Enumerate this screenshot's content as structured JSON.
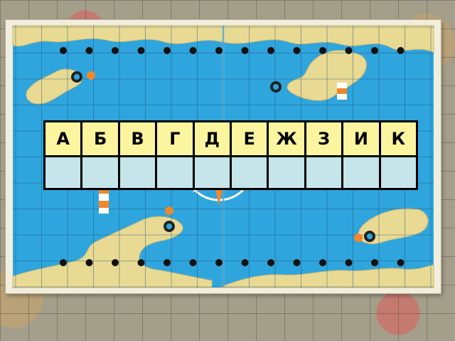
{
  "game": {
    "letters": [
      "А",
      "Б",
      "В",
      "Г",
      "Д",
      "Е",
      "Ж",
      "З",
      "И",
      "К"
    ],
    "answers": [
      "",
      "",
      "",
      "",
      "",
      "",
      "",
      "",
      "",
      ""
    ]
  },
  "colors": {
    "sea": "#2fa5dd",
    "land": "#e9da93",
    "grid": "#1a4f7a",
    "letter_cell": "#fbf5a0",
    "answer_cell": "#c6e5ea",
    "marker": "#f0872a"
  },
  "icons": {
    "node": "black-dot",
    "cannon": "cannon-icon",
    "lighthouse": "lighthouse-icon",
    "compass": "compass-rose-icon"
  }
}
